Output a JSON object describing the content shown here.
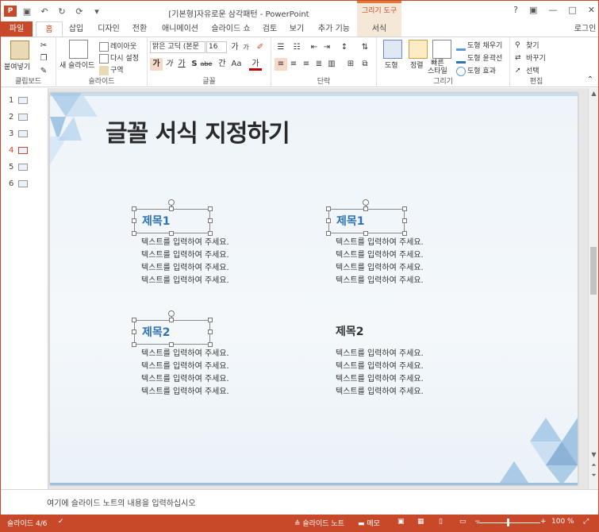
{
  "titlebar": {
    "app_icon": "P",
    "doc_title": "[기본형]자유로운 삼각패턴 - PowerPoint",
    "context_tab_header": "그리기 도구",
    "qat_icons": [
      "save-icon",
      "undo-icon",
      "redo-icon",
      "repeat-icon",
      "more-icon"
    ],
    "help": "?",
    "restore": "▣",
    "minimize": "—",
    "maximize": "□",
    "close": "✕"
  },
  "tabs": {
    "file": "파일",
    "home": "홈",
    "insert": "삽입",
    "design": "디자인",
    "transitions": "전환",
    "animations": "애니메이션",
    "slideshow": "슬라이드 쇼",
    "review": "검토",
    "view": "보기",
    "addins": "추가 기능",
    "format": "서식",
    "login": "로그인"
  },
  "ribbon": {
    "clipboard": {
      "label": "클립보드",
      "paste": "붙여넣기"
    },
    "slides": {
      "label": "슬라이드",
      "new_slide": "새 슬라이드",
      "layout": "레이아웃",
      "reset": "다시 설정",
      "section": "구역"
    },
    "font": {
      "label": "글꼴",
      "font_name": "맑은 고딕 (본문",
      "font_size": "16",
      "grow": "가",
      "shrink": "가",
      "bold": "가",
      "italic": "가",
      "underline": "가",
      "shadow": "S",
      "strike": "abe",
      "spacing": "간",
      "case": "Aa",
      "color": "가"
    },
    "paragraph": {
      "label": "단락"
    },
    "drawing": {
      "label": "그리기",
      "shape": "도형",
      "arrange": "정렬",
      "quick_styles": "빠른\n스타일",
      "fill": "도형 채우기",
      "outline": "도형 윤곽선",
      "effects": "도형 효과"
    },
    "editing": {
      "label": "편집",
      "find": "찾기",
      "replace": "바꾸기",
      "select": "선택"
    }
  },
  "thumbnails": [
    {
      "num": "1"
    },
    {
      "num": "2"
    },
    {
      "num": "3"
    },
    {
      "num": "4"
    },
    {
      "num": "5"
    },
    {
      "num": "6"
    }
  ],
  "slide": {
    "title": "글꼴 서식 지정하기",
    "blocks": [
      {
        "heading": "제목1",
        "lines": [
          "텍스트를 입력하여 주세요.",
          "텍스트를 입력하여 주세요.",
          "텍스트를 입력하여 주세요.",
          "텍스트를 입력하여 주세요."
        ]
      },
      {
        "heading": "제목1",
        "lines": [
          "텍스트를 입력하여 주세요.",
          "텍스트를 입력하여 주세요.",
          "텍스트를 입력하여 주세요.",
          "텍스트를 입력하여 주세요."
        ]
      },
      {
        "heading": "제목2",
        "lines": [
          "텍스트를 입력하여 주세요.",
          "텍스트를 입력하여 주세요.",
          "텍스트를 입력하여 주세요.",
          "텍스트를 입력하여 주세요."
        ]
      },
      {
        "heading": "제목2",
        "lines": [
          "텍스트를 입력하여 주세요.",
          "텍스트를 입력하여 주세요.",
          "텍스트를 입력하여 주세요.",
          "텍스트를 입력하여 주세요."
        ]
      }
    ]
  },
  "notes": {
    "placeholder": "여기에 슬라이드 노트의 내용을 입력하십시오"
  },
  "status": {
    "slide_pos": "슬라이드 4/6",
    "notes_btn": "슬라이드 노트",
    "comments_btn": "메모",
    "zoom": "100 %",
    "zoom_minus": "−",
    "zoom_plus": "+"
  },
  "colors": {
    "accent": "#c8482a",
    "heading_blue": "#2e74b5"
  }
}
